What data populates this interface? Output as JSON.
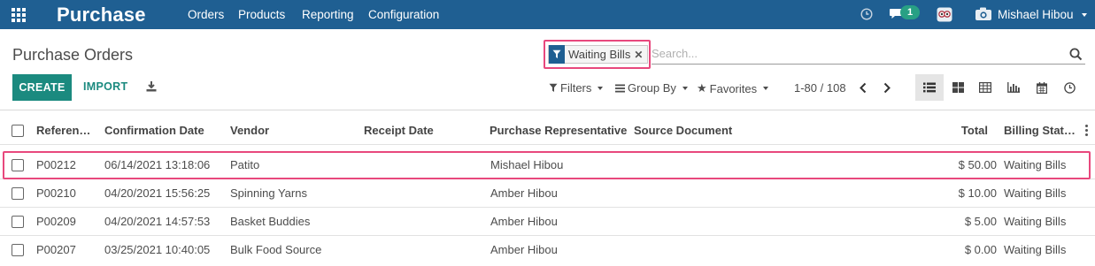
{
  "navbar": {
    "brand": "Purchase",
    "menu": [
      "Orders",
      "Products",
      "Reporting",
      "Configuration"
    ],
    "messages_count": "1",
    "user_name": "Mishael Hibou",
    "bg_color": "#1f5f92"
  },
  "control_panel": {
    "title": "Purchase Orders",
    "facet_label": "Waiting Bills",
    "search_placeholder": "Search...",
    "create_label": "CREATE",
    "import_label": "IMPORT",
    "filters_label": "Filters",
    "groupby_label": "Group By",
    "favorites_label": "Favorites",
    "pager": "1-80 / 108",
    "accent_color": "#1b8a7f",
    "highlight_color": "#e8487d"
  },
  "table": {
    "columns": [
      "Referen…",
      "Confirmation Date",
      "Vendor",
      "Receipt Date",
      "Purchase Representative",
      "Source Document",
      "Total",
      "Billing Stat…"
    ],
    "rows": [
      {
        "ref": "P00212",
        "date": "06/14/2021 13:18:06",
        "vendor": "Patito",
        "receipt": "",
        "rep": "Mishael Hibou",
        "source": "",
        "total": "$ 50.00",
        "status": "Waiting Bills"
      },
      {
        "ref": "P00210",
        "date": "04/20/2021 15:56:25",
        "vendor": "Spinning Yarns",
        "receipt": "",
        "rep": "Amber Hibou",
        "source": "",
        "total": "$ 10.00",
        "status": "Waiting Bills"
      },
      {
        "ref": "P00209",
        "date": "04/20/2021 14:57:53",
        "vendor": "Basket Buddies",
        "receipt": "",
        "rep": "Amber Hibou",
        "source": "",
        "total": "$ 5.00",
        "status": "Waiting Bills"
      },
      {
        "ref": "P00207",
        "date": "03/25/2021 10:40:05",
        "vendor": "Bulk Food Source",
        "receipt": "",
        "rep": "Amber Hibou",
        "source": "",
        "total": "$ 0.00",
        "status": "Waiting Bills"
      }
    ]
  },
  "icons": [
    "apps-icon",
    "clock-icon",
    "chat-icon",
    "owl-avatar-icon",
    "camera-avatar-icon",
    "filter-icon",
    "close-icon",
    "search-icon",
    "download-icon",
    "list-view-icon",
    "kanban-view-icon",
    "pivot-view-icon",
    "graph-view-icon",
    "calendar-view-icon",
    "activity-view-icon"
  ]
}
